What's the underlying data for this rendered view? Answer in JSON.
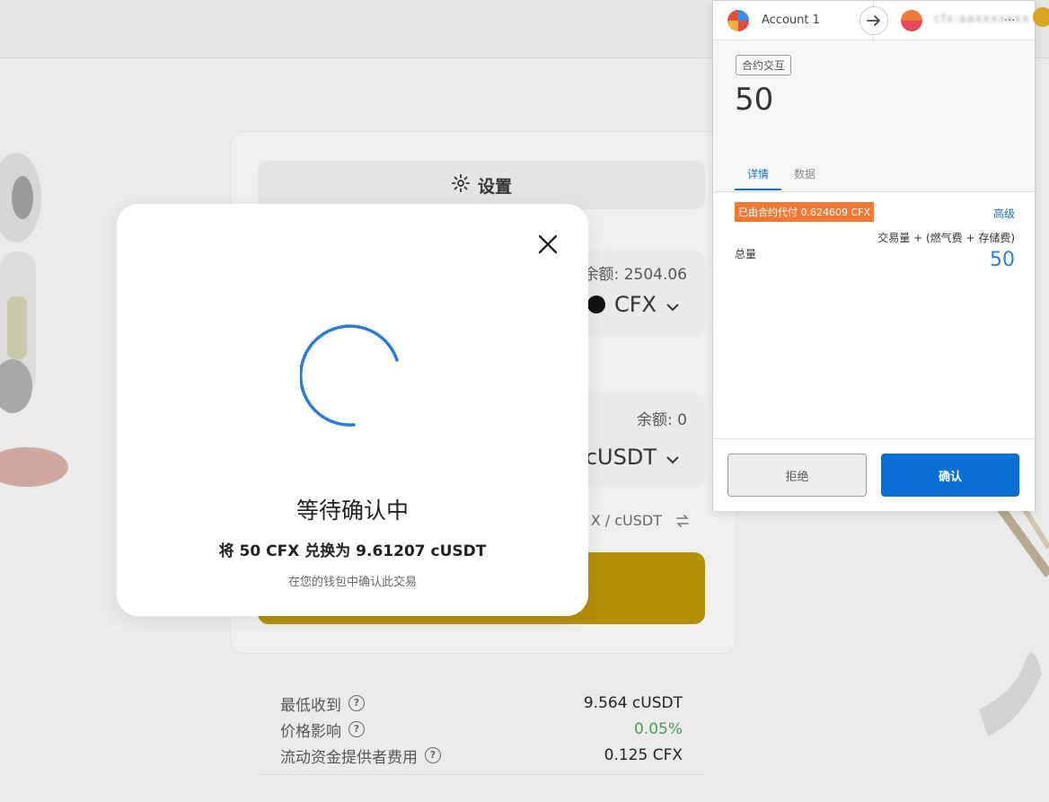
{
  "swap": {
    "settings_label": "设置",
    "from": {
      "balance": "余额: 2504.06",
      "token": "CFX"
    },
    "to": {
      "balance": "余额: 0",
      "token": "cUSDT"
    },
    "rate": "X / cUSDT"
  },
  "info": {
    "rows": [
      {
        "label": "最低收到",
        "value": "9.564 cUSDT"
      },
      {
        "label": "价格影响",
        "value": "0.05%"
      },
      {
        "label": "流动资金提供者费用",
        "value": "0.125 CFX"
      }
    ]
  },
  "modal": {
    "title": "等待确认中",
    "subtitle": "将 50 CFX 兑换为 9.61207 cUSDT",
    "hint": "在您的钱包中确认此交易"
  },
  "wallet": {
    "account_name": "Account 1",
    "to_address": "cfx:aaxxxxxxx",
    "to_address_ellipsis": "...",
    "badge": "合约交互",
    "amount": "50",
    "tabs": [
      "详情",
      "数据"
    ],
    "fee_tag": "已由合约代付 0.624609 CFX",
    "advanced": "高级",
    "formula": "交易量 + (燃气费 + 存储费)",
    "total_label": "总量",
    "total_value": "50",
    "reject": "拒绝",
    "confirm": "确认"
  },
  "colors": {
    "accent": "#0a6fd4",
    "fee_tag": "#f27a34",
    "swap_button": "#b58f05",
    "spinner": "#2b7ad8"
  }
}
